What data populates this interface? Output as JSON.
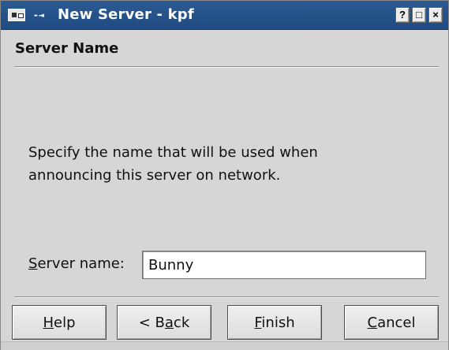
{
  "window": {
    "title": "New Server - kpf",
    "sticky_symbol": "-⇥",
    "title_buttons": {
      "help": "?",
      "maximize": "□",
      "close": "×"
    }
  },
  "wizard": {
    "section_title": "Server Name",
    "description": "Specify the name that will be used when\nannouncing this server on network.",
    "field": {
      "label_mnemonic": "S",
      "label_rest": "erver name:",
      "value": "Bunny"
    },
    "buttons": {
      "help_mnemonic": "H",
      "help_rest": "elp",
      "back_prefix": "< B",
      "back_mnemonic": "a",
      "back_rest": "ck",
      "finish_mnemonic": "F",
      "finish_rest": "inish",
      "cancel_mnemonic": "C",
      "cancel_rest": "ancel"
    }
  },
  "colors": {
    "titlebar": "#1f4b82",
    "window_bg": "#d6d6d6",
    "text": "#111111"
  },
  "icons": {
    "app": "kpf-app-icon",
    "sticky": "sticky-pin-icon",
    "help": "help-icon",
    "maximize": "maximize-icon",
    "close": "close-icon"
  }
}
